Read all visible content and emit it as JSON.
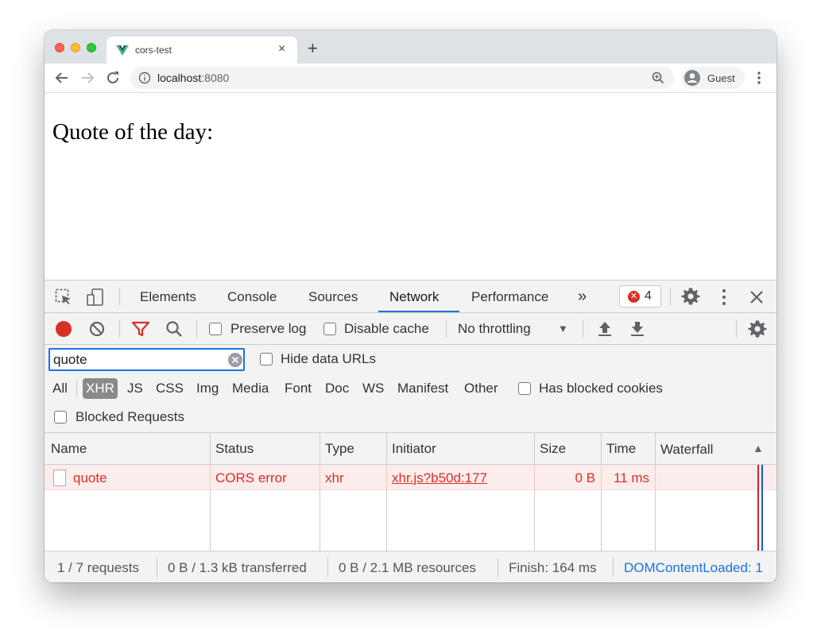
{
  "browser": {
    "tab_title": "cors-test",
    "new_tab": "+",
    "tab_close": "×",
    "url_host": "localhost",
    "url_port": ":8080",
    "profile_label": "Guest"
  },
  "page": {
    "heading": "Quote of the day:"
  },
  "devtools": {
    "tabs": [
      "Elements",
      "Console",
      "Sources",
      "Network",
      "Performance"
    ],
    "more_tabs": "»",
    "error_count": "4",
    "error_symbol": "✕",
    "toolbar": {
      "preserve_log": "Preserve log",
      "disable_cache": "Disable cache",
      "throttling": "No throttling",
      "throttling_arrow": "▼"
    },
    "filter": {
      "value": "quote",
      "hide_data_urls": "Hide data URLs",
      "types": [
        "All",
        "XHR",
        "JS",
        "CSS",
        "Img",
        "Media",
        "Font",
        "Doc",
        "WS",
        "Manifest",
        "Other"
      ],
      "selected_type": "XHR",
      "has_blocked_cookies": "Has blocked cookies",
      "blocked_requests": "Blocked Requests"
    },
    "columns": [
      "Name",
      "Status",
      "Type",
      "Initiator",
      "Size",
      "Time",
      "Waterfall"
    ],
    "sort_arrow": "▲",
    "rows": [
      {
        "name": "quote",
        "status": "CORS error",
        "type": "xhr",
        "initiator": "xhr.js?b50d:177",
        "size": "0 B",
        "time": "11 ms"
      }
    ],
    "status_bar": {
      "requests": "1 / 7 requests",
      "transferred": "0 B / 1.3 kB transferred",
      "resources": "0 B / 2.1 MB resources",
      "finish": "Finish: 164 ms",
      "dom_content_loaded": "DOMContentLoaded: 1"
    }
  },
  "colors": {
    "error": "#d93025",
    "accent": "#1a73e8",
    "error_row_bg": "#fdecec"
  }
}
